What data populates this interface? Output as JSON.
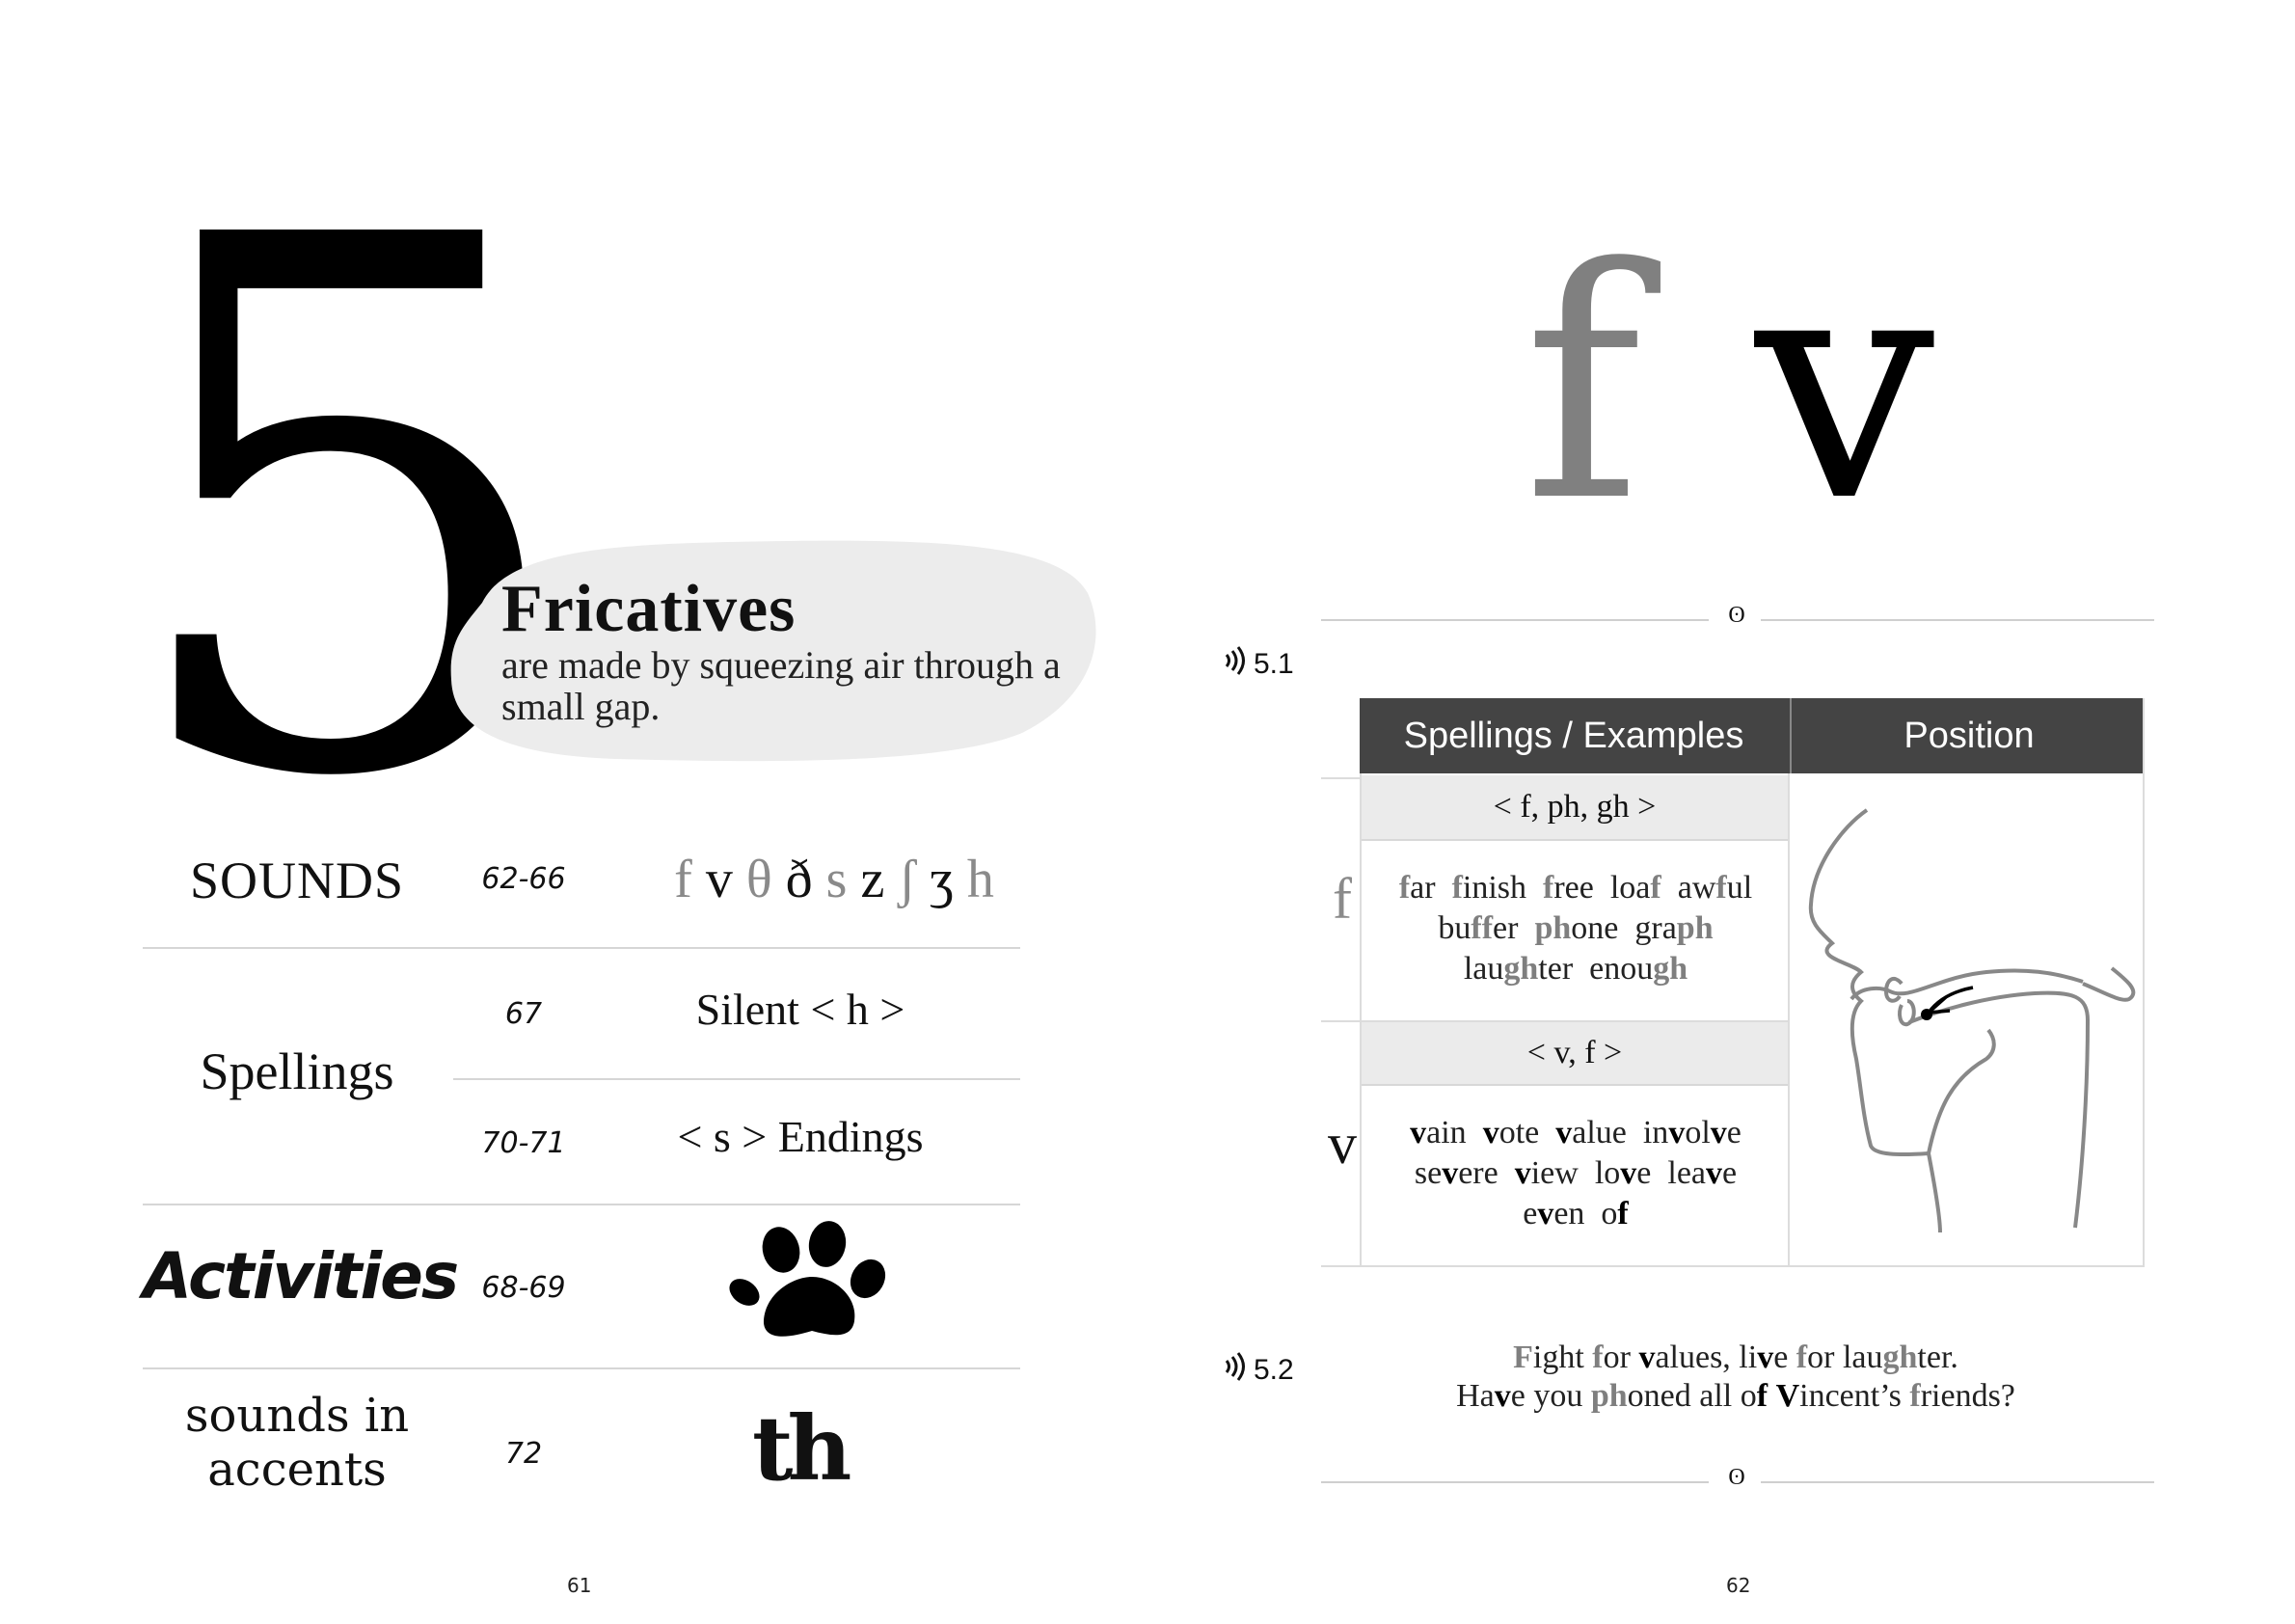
{
  "left_page": {
    "chapter_number": "5",
    "title": "Fricatives",
    "description": "are made by squeezing air through a small gap.",
    "rows": {
      "sounds": {
        "label": "SOUNDS",
        "pages": "62-66",
        "ipa": [
          "f",
          "v",
          "θ",
          "ð",
          "s",
          "z",
          "ʃ",
          "ʒ",
          "h"
        ]
      },
      "spellings": {
        "label": "Spellings",
        "items": [
          {
            "pages": "67",
            "text": "Silent < h >"
          },
          {
            "pages": "70-71",
            "text": "< s > Endings"
          }
        ]
      },
      "activities": {
        "label": "Activities",
        "pages": "68-69",
        "icon": "paw-icon"
      },
      "accents": {
        "label": "sounds in accents",
        "pages": "72",
        "glyph": "th"
      }
    },
    "page_number": "61"
  },
  "right_page": {
    "heading_f": "f",
    "heading_v": "v",
    "ornament": "ʘ",
    "audio_1": "5.1",
    "audio_2": "5.2",
    "table": {
      "headers": [
        "Spellings / Examples",
        "Position"
      ],
      "rows": [
        {
          "letter": "f",
          "spellings": "< f, ph, gh >",
          "examples": "far finish free loaf awful buffer phone graph laughter enough"
        },
        {
          "letter": "v",
          "spellings": "< v, f >",
          "examples": "vain vote value involve severe view love leave even of"
        }
      ],
      "position_image": "mouth-cross-section-diagram"
    },
    "sentences": [
      "Fight for values, live for laughter.",
      "Have you phoned all of Vincent’s friends?"
    ],
    "page_number": "62"
  }
}
